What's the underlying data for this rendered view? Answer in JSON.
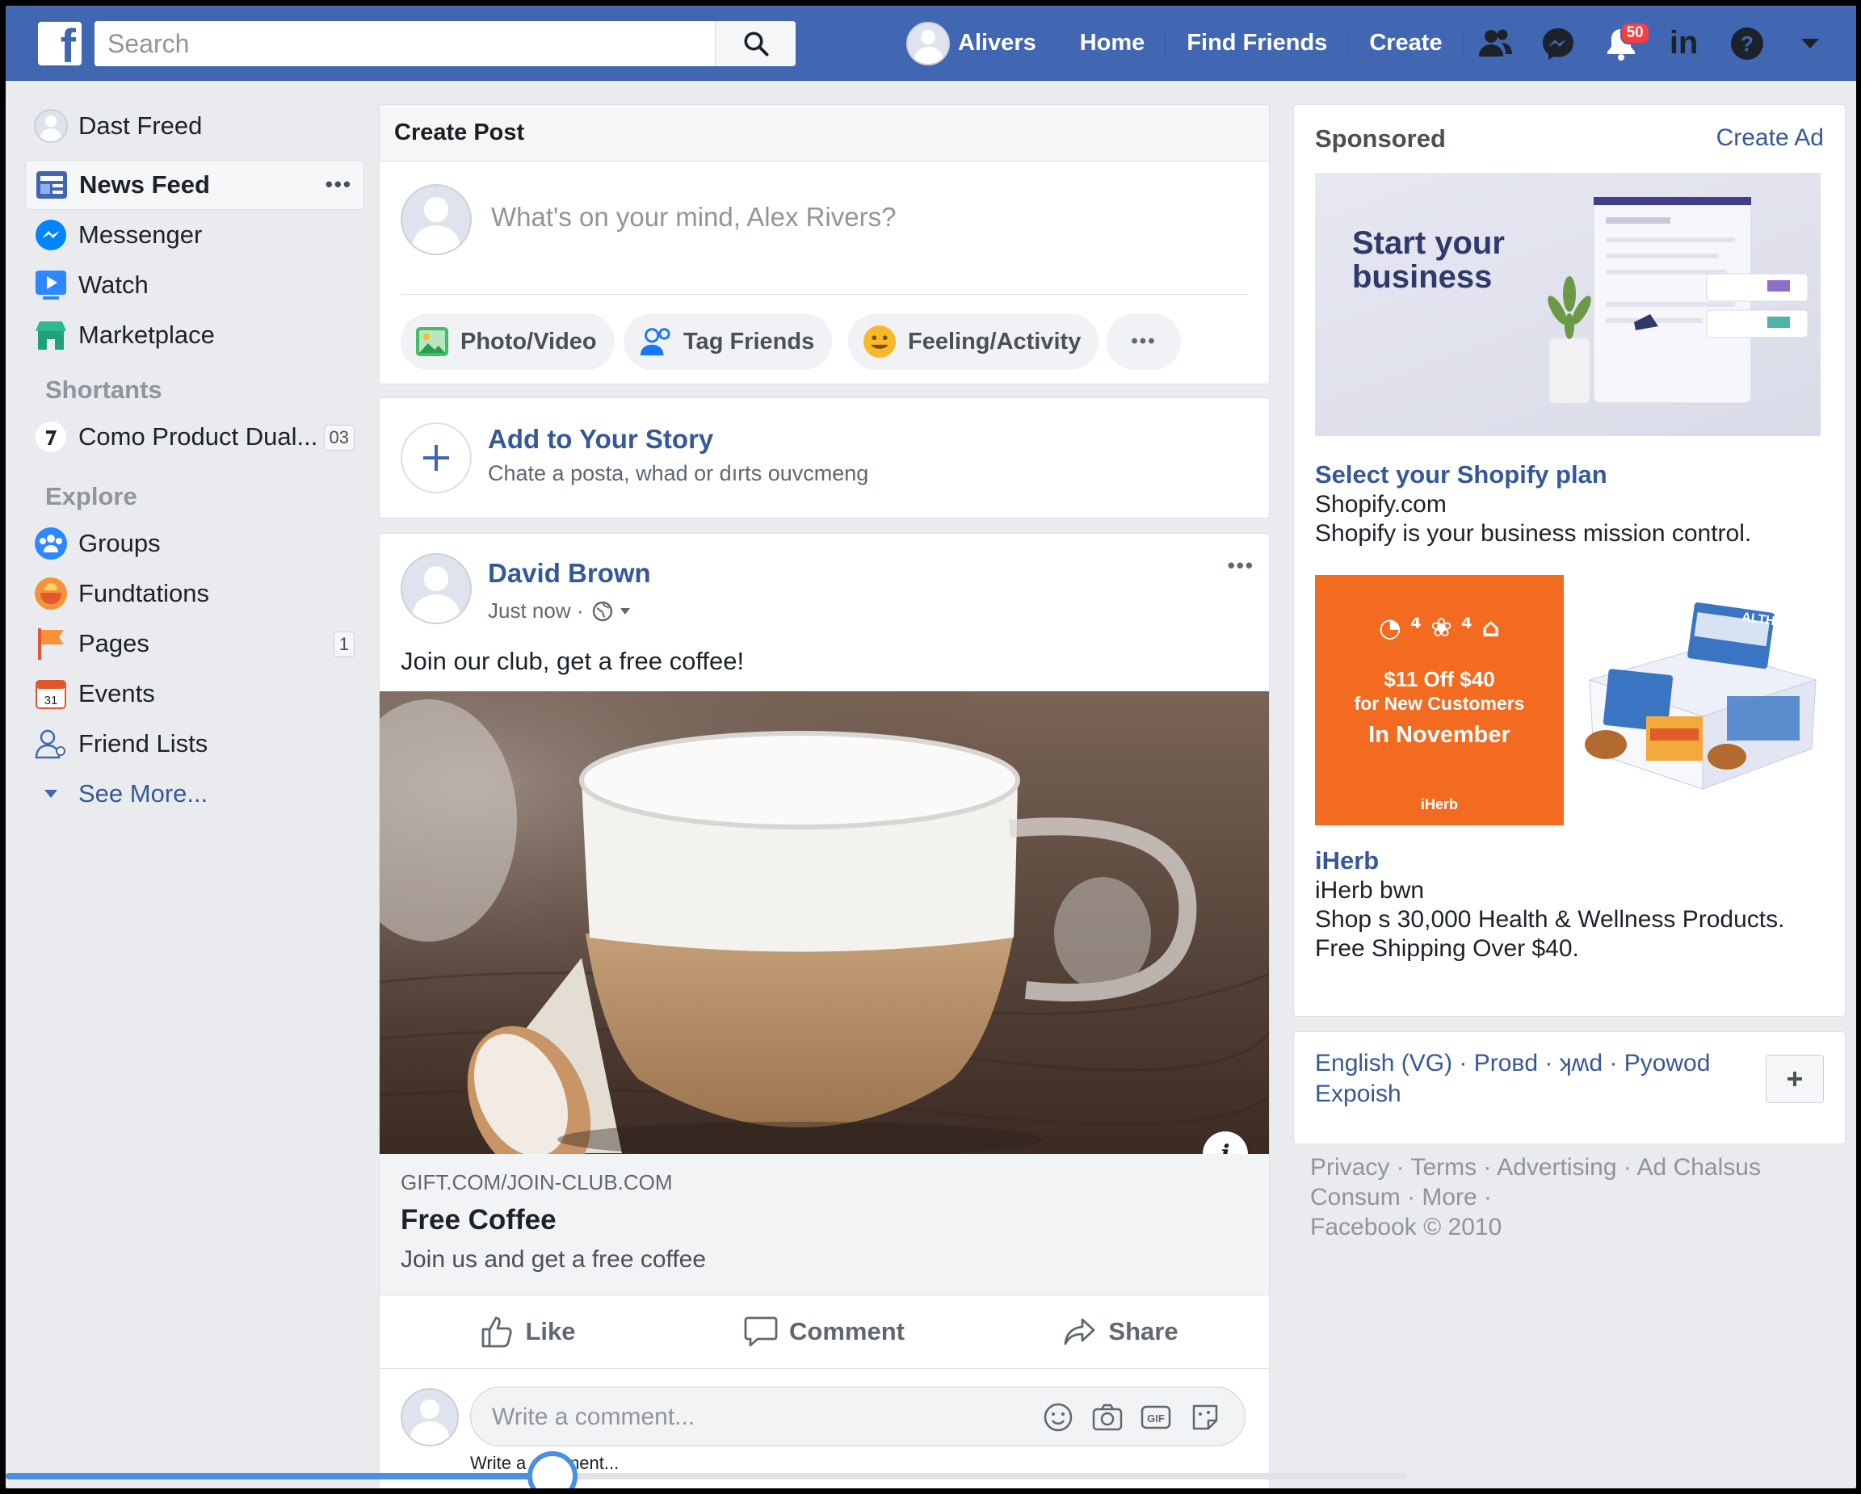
{
  "topbar": {
    "logo": "f",
    "search_placeholder": "Search",
    "user_name": "Alivers",
    "links": [
      "Home",
      "Find Friends",
      "Create"
    ],
    "notifications_count": "50"
  },
  "sidebar": {
    "profile_name": "Dast Freed",
    "main_items": [
      {
        "label": "News Feed",
        "icon": "news-feed-icon"
      },
      {
        "label": "Messenger",
        "icon": "messenger-icon"
      },
      {
        "label": "Watch",
        "icon": "watch-icon"
      },
      {
        "label": "Marketplace",
        "icon": "marketplace-icon"
      }
    ],
    "shortcuts_heading": "Shortants",
    "shortcut": {
      "label": "Como Product Dual...",
      "count": "03"
    },
    "explore_heading": "Explore",
    "explore_items": [
      {
        "label": "Groups",
        "icon": "groups-icon"
      },
      {
        "label": "Fundtations",
        "icon": "fundraisers-icon"
      },
      {
        "label": "Pages",
        "icon": "pages-flag-icon",
        "count": "1"
      },
      {
        "label": "Events",
        "icon": "calendar-icon"
      },
      {
        "label": "Friend Lists",
        "icon": "friend-lists-icon"
      }
    ],
    "see_more": "See More..."
  },
  "create_post": {
    "header": "Create Post",
    "placeholder": "What's on your mind, Alex Rivers?",
    "actions": [
      "Photo/Video",
      "Tag Friends",
      "Feeling/Activity"
    ]
  },
  "story": {
    "title": "Add to Your Story",
    "subtitle": "Chate a posta, whad or dırts ouvcmeng"
  },
  "post": {
    "author": "David Brown",
    "time": "Just now ·",
    "text": "Join our club, get a free coffee!",
    "link_domain": "GIFT.COM/JOIN-CLUB.COM",
    "link_title": "Free Coffee",
    "link_desc": "Join us and get a free coffee",
    "actions": [
      "Like",
      "Comment",
      "Share"
    ],
    "comment_placeholder": "Write a comment...",
    "comment_hint": "Write a comment..."
  },
  "sponsored": {
    "heading": "Sponsored",
    "create_ad": "Create Ad",
    "ad1": {
      "image_text": "Start your business",
      "title": "Select your Shopify plan",
      "domain": "Shopify.com",
      "desc": "Shopify is your business mission control."
    },
    "ad2": {
      "banner_line1": "$11 Off $40",
      "banner_line2": "for New Customers",
      "banner_line3": "In November",
      "banner_brand": "iHerb",
      "box_text": "ALTHG CLIFFENS",
      "title": "iHerb",
      "domain": "iHerb bwn",
      "desc1": "Shop s 30,000 Health & Wellness Products.",
      "desc2": "Free Shipping Over $40."
    }
  },
  "languages": {
    "line1": "English (VG) · Proвd · ʞʍd · Pyowod",
    "line2": "Expoish"
  },
  "footer": {
    "line1": "Privacy · Terms · Advertising · Ad Chalsus",
    "line2": "Consum · More ·",
    "line3": "Facebook © 2010"
  },
  "scroll_progress": 0.39,
  "colors": {
    "brand": "#4267b2",
    "link": "#365899",
    "badge": "#fa3e3e",
    "ad_orange": "#f36b21"
  }
}
